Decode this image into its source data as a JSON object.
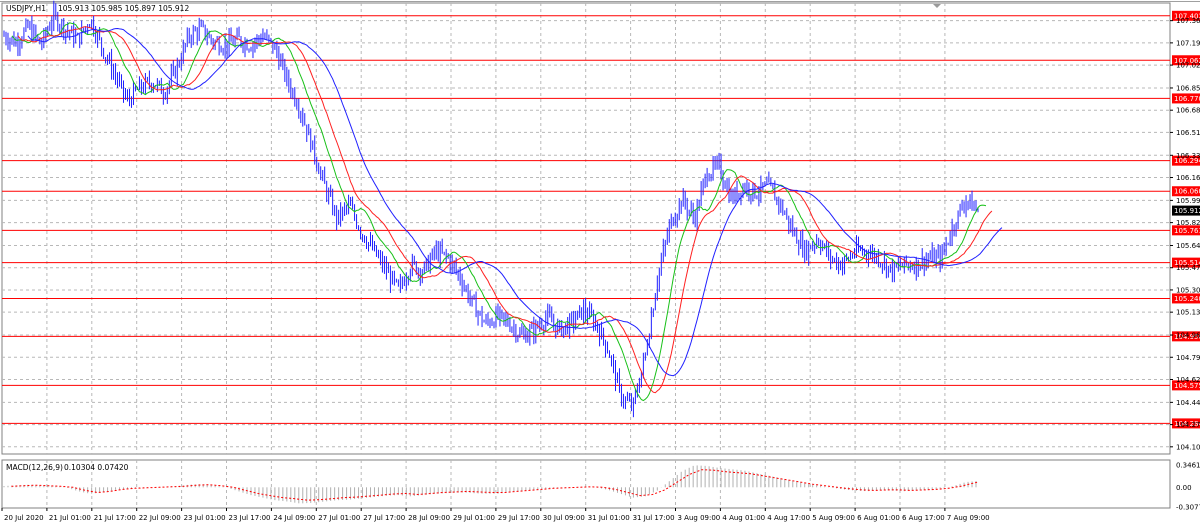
{
  "header": {
    "symbol": "USDJPY,H1",
    "ohlc": "105.913 105.985 105.897 105.912"
  },
  "macd": {
    "label": "MACD(12,26,9)",
    "values": "0.10304 0.07420"
  },
  "macd_axis": [
    "0.34618",
    "0.00",
    "-0.30774"
  ],
  "colors": {
    "candle": "#1f1fff",
    "ma_fast": "#18c018",
    "ma_mid": "#ff2020",
    "ma_slow": "#2020ff",
    "hline": "#ff0000",
    "grid": "#b8b8b8",
    "badge": "#ff0000",
    "current_badge": "#000000"
  },
  "chart_data": {
    "type": "candlestick",
    "ylim": [
      104.05,
      107.5
    ],
    "y_ticks": [
      "107.365",
      "107.195",
      "107.025",
      "106.850",
      "106.680",
      "106.510",
      "106.335",
      "106.165",
      "105.990",
      "105.820",
      "105.645",
      "105.475",
      "105.305",
      "105.135",
      "104.960",
      "104.790",
      "104.620",
      "104.445",
      "104.275",
      "104.105"
    ],
    "x_ticks": [
      "20 Jul 2020",
      "21 Jul 01:00",
      "21 Jul 17:00",
      "22 Jul 09:00",
      "23 Jul 01:00",
      "23 Jul 17:00",
      "24 Jul 09:00",
      "27 Jul 01:00",
      "27 Jul 17:00",
      "28 Jul 09:00",
      "29 Jul 01:00",
      "29 Jul 17:00",
      "30 Jul 09:00",
      "31 Jul 01:00",
      "31 Jul 17:00",
      "3 Aug 09:00",
      "4 Aug 01:00",
      "4 Aug 17:00",
      "5 Aug 09:00",
      "6 Aug 01:00",
      "6 Aug 17:00",
      "7 Aug 09:00"
    ],
    "current_price": "105.912",
    "levels": [
      "107.402",
      "107.062",
      "106.770",
      "106.294",
      "106.060",
      "105.761",
      "105.514",
      "105.240",
      "104.950",
      "104.575",
      "104.284"
    ],
    "price_path": [
      107.25,
      107.2,
      107.32,
      107.18,
      107.4,
      107.3,
      107.22,
      107.38,
      107.15,
      106.95,
      106.75,
      106.85,
      106.9,
      106.82,
      107.0,
      107.25,
      107.3,
      107.2,
      107.18,
      107.22,
      107.18,
      107.25,
      107.15,
      106.9,
      106.7,
      106.4,
      106.1,
      105.85,
      105.95,
      105.75,
      105.6,
      105.45,
      105.3,
      105.5,
      105.45,
      105.6,
      105.55,
      105.4,
      105.2,
      105.05,
      105.1,
      105.05,
      104.95,
      105.0,
      105.1,
      105.0,
      105.05,
      105.15,
      105.05,
      104.85,
      104.5,
      104.4,
      104.8,
      105.4,
      105.8,
      106.0,
      105.85,
      106.2,
      106.25,
      106.0,
      106.1,
      106.05,
      106.1,
      105.95,
      105.75,
      105.6,
      105.7,
      105.55,
      105.5,
      105.6,
      105.6,
      105.55,
      105.45,
      105.5,
      105.5,
      105.55,
      105.55,
      105.8,
      106.0,
      105.91
    ],
    "macd_path": [
      0.02,
      0.03,
      0.04,
      0.03,
      0.02,
      0.0,
      -0.06,
      -0.1,
      -0.08,
      -0.04,
      -0.02,
      -0.01,
      0.0,
      0.01,
      0.02,
      0.04,
      0.05,
      0.03,
      0.0,
      -0.06,
      -0.12,
      -0.16,
      -0.2,
      -0.22,
      -0.25,
      -0.24,
      -0.22,
      -0.2,
      -0.19,
      -0.17,
      -0.15,
      -0.13,
      -0.12,
      -0.14,
      -0.12,
      -0.1,
      -0.09,
      -0.08,
      -0.09,
      -0.1,
      -0.1,
      -0.08,
      -0.06,
      -0.04,
      -0.02,
      -0.01,
      0.0,
      0.01,
      0.0,
      -0.04,
      -0.1,
      -0.16,
      -0.14,
      -0.05,
      0.1,
      0.25,
      0.34,
      0.33,
      0.3,
      0.28,
      0.26,
      0.22,
      0.18,
      0.14,
      0.1,
      0.06,
      0.03,
      0.0,
      -0.03,
      -0.05,
      -0.06,
      -0.05,
      -0.05,
      -0.06,
      -0.05,
      -0.04,
      -0.02,
      0.02,
      0.08,
      0.1
    ]
  }
}
